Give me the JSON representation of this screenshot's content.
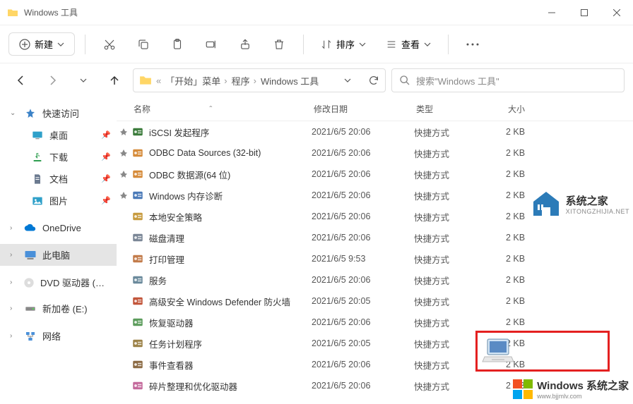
{
  "window": {
    "title": "Windows 工具"
  },
  "toolbar": {
    "new": "新建",
    "sort": "排序",
    "view": "查看"
  },
  "breadcrumb": {
    "parts": [
      "「开始」菜单",
      "程序",
      "Windows 工具"
    ]
  },
  "search": {
    "placeholder": "搜索\"Windows 工具\""
  },
  "sidebar": {
    "quick": "快速访问",
    "desktop": "桌面",
    "downloads": "下载",
    "documents": "文档",
    "pictures": "图片",
    "onedrive": "OneDrive",
    "thispc": "此电脑",
    "dvd": "DVD 驱动器 (D:) CC",
    "volume": "新加卷 (E:)",
    "network": "网络"
  },
  "columns": {
    "name": "名称",
    "date": "修改日期",
    "type": "类型",
    "size": "大小"
  },
  "files": [
    {
      "pinned": true,
      "name": "iSCSI 发起程序",
      "date": "2021/6/5 20:06",
      "type": "快捷方式",
      "size": "2 KB"
    },
    {
      "pinned": true,
      "name": "ODBC Data Sources (32-bit)",
      "date": "2021/6/5 20:06",
      "type": "快捷方式",
      "size": "2 KB"
    },
    {
      "pinned": true,
      "name": "ODBC 数据源(64 位)",
      "date": "2021/6/5 20:06",
      "type": "快捷方式",
      "size": "2 KB"
    },
    {
      "pinned": true,
      "name": "Windows 内存诊断",
      "date": "2021/6/5 20:06",
      "type": "快捷方式",
      "size": "2 KB"
    },
    {
      "pinned": false,
      "name": "本地安全策略",
      "date": "2021/6/5 20:06",
      "type": "快捷方式",
      "size": "2 KB"
    },
    {
      "pinned": false,
      "name": "磁盘清理",
      "date": "2021/6/5 20:06",
      "type": "快捷方式",
      "size": "2 KB"
    },
    {
      "pinned": false,
      "name": "打印管理",
      "date": "2021/6/5 9:53",
      "type": "快捷方式",
      "size": "2 KB"
    },
    {
      "pinned": false,
      "name": "服务",
      "date": "2021/6/5 20:06",
      "type": "快捷方式",
      "size": "2 KB"
    },
    {
      "pinned": false,
      "name": "高级安全 Windows Defender 防火墙",
      "date": "2021/6/5 20:05",
      "type": "快捷方式",
      "size": "2 KB"
    },
    {
      "pinned": false,
      "name": "恢复驱动器",
      "date": "2021/6/5 20:06",
      "type": "快捷方式",
      "size": "2 KB"
    },
    {
      "pinned": false,
      "name": "任务计划程序",
      "date": "2021/6/5 20:05",
      "type": "快捷方式",
      "size": "2 KB"
    },
    {
      "pinned": false,
      "name": "事件查看器",
      "date": "2021/6/5 20:06",
      "type": "快捷方式",
      "size": "2 KB"
    },
    {
      "pinned": false,
      "name": "碎片整理和优化驱动器",
      "date": "2021/6/5 20:06",
      "type": "快捷方式",
      "size": "2 KB"
    }
  ],
  "watermarks": {
    "wm1_main": "系统之家",
    "wm1_sub": "XITONGZHIJIA.NET",
    "wm2_main": "Windows 系统之家",
    "wm2_sub": "www.bjjmlv.com"
  }
}
